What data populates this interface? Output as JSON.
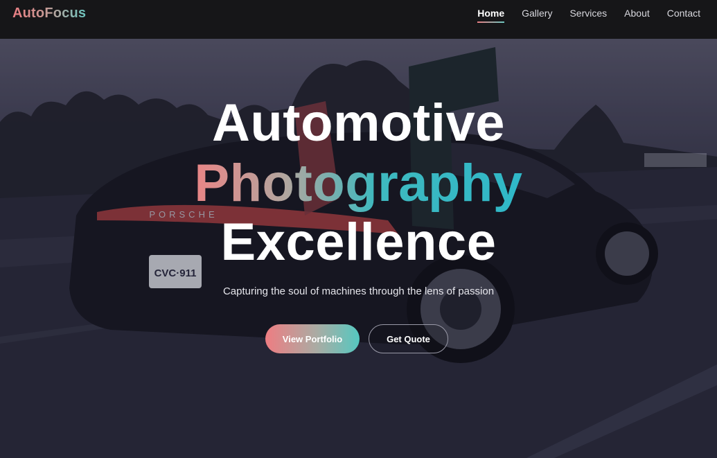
{
  "brand": {
    "part1": "Auto",
    "part2": "Focus"
  },
  "nav": {
    "items": [
      {
        "label": "Home",
        "active": true
      },
      {
        "label": "Gallery",
        "active": false
      },
      {
        "label": "Services",
        "active": false
      },
      {
        "label": "About",
        "active": false
      },
      {
        "label": "Contact",
        "active": false
      }
    ]
  },
  "hero": {
    "line1": "Automotive",
    "line2": "Photography",
    "line3": "Excellence",
    "tagline": "Capturing the soul of machines through the lens of passion",
    "primary_cta": "View Portfolio",
    "secondary_cta": "Get Quote",
    "background_image": {
      "plate_text": "CVC·911",
      "badge_text": "PORSCHE"
    }
  },
  "colors": {
    "accent_pink": "#e97d82",
    "accent_teal": "#3fb9bf",
    "nav_bg": "#161618"
  }
}
